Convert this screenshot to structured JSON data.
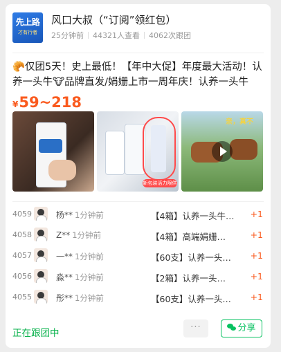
{
  "group": {
    "logo_line1": "先上路",
    "logo_line2": "才有行者",
    "title": "风口大叔（“订阅”领红包）",
    "posted": "25分钟前",
    "views": "44321人查看",
    "follows": "4062次跟团"
  },
  "post": {
    "description": "🥐仅团5天！史上最低！【年中大促】年度最大活动！认养一头牛🐮品牌直发/娟姗上市一周年庆！认养一头牛",
    "currency": "¥",
    "price": "59~218",
    "thumb_badge": "新包装活力限供",
    "thumb3_caption": "亲，真不"
  },
  "orders": [
    {
      "num": "4059",
      "name": "杨**",
      "time": "1分钟前",
      "item": "【4箱】认养一头牛…",
      "qty": "+1"
    },
    {
      "num": "4058",
      "name": "Z**",
      "time": "1分钟前",
      "item": "【4箱】高端娟姗…",
      "qty": "+1"
    },
    {
      "num": "4057",
      "name": "一**",
      "time": "1分钟前",
      "item": "【60支】认养一头…",
      "qty": "+1"
    },
    {
      "num": "4056",
      "name": "淼**",
      "time": "1分钟前",
      "item": "【2箱】认养一头…",
      "qty": "+1"
    },
    {
      "num": "4055",
      "name": "彤**",
      "time": "1分钟前",
      "item": "【60支】认养一头…",
      "qty": "+1"
    }
  ],
  "footer": {
    "status": "正在跟团中",
    "more": "···",
    "share": "分享"
  },
  "colors": {
    "accent_green": "#07c160",
    "price_orange": "#fa5a1e"
  }
}
